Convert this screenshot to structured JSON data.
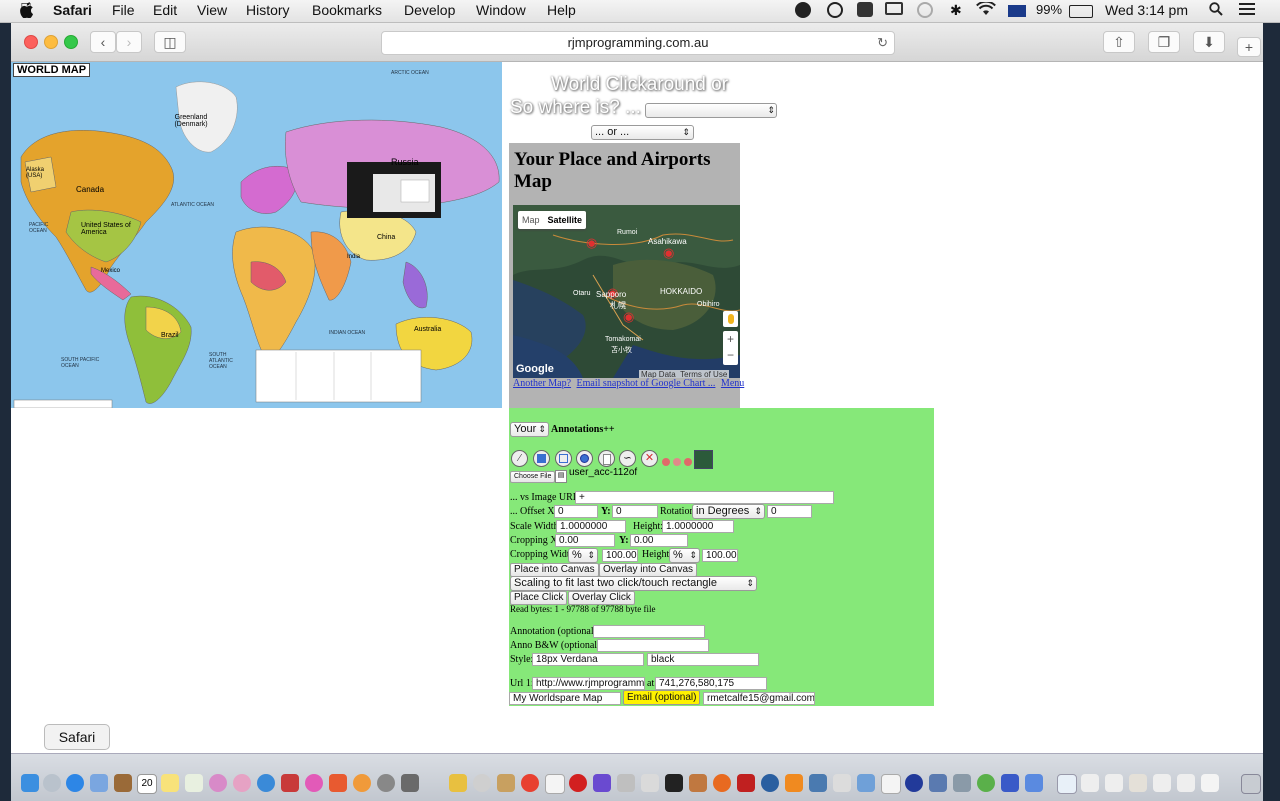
{
  "menubar": {
    "app": "Safari",
    "items": [
      "File",
      "Edit",
      "View",
      "History",
      "Bookmarks",
      "Develop",
      "Window",
      "Help"
    ],
    "battery": "99%",
    "clock": "Wed 3:14 pm"
  },
  "browser": {
    "url": "rjmprogramming.com.au"
  },
  "worldmap": {
    "title": "WORLD MAP",
    "labels": [
      "Greenland (Denmark)",
      "Canada",
      "Alaska (USA)",
      "United States of America",
      "Mexico",
      "Brazil",
      "Russia",
      "China",
      "India",
      "Australia",
      "ATLANTIC OCEAN",
      "PACIFIC OCEAN",
      "INDIAN OCEAN",
      "SOUTH ATLANTIC OCEAN",
      "SOUTH PACIFIC OCEAN",
      "ARCTIC OCEAN"
    ]
  },
  "heading": {
    "line1": "World Clickaround or",
    "line2": "So where is? ...",
    "or_select": "... or ..."
  },
  "place_panel": {
    "title": "Your Place and Airports Map",
    "map_tab": "Map",
    "satellite_tab": "Satellite",
    "map_labels": [
      "Rumoi",
      "Asahikawa",
      "HOKKAIDO",
      "Otaru",
      "Sapporo",
      "札幌",
      "Obihiro",
      "Tomakomai",
      "苫小牧"
    ],
    "google": "Google",
    "map_data": "Map Data",
    "terms": "Terms of Use",
    "zoom_in": "+",
    "zoom_out": "−",
    "links": [
      "Another Map?",
      "Email snapshot of Google Chart ...",
      "Menu"
    ]
  },
  "annotations": {
    "whose_select": "Your",
    "title": "Annotations++",
    "choose_file": "Choose File",
    "file_name": "user_acc-112of",
    "vs_image_url_label": "... vs Image URL:",
    "vs_image_url_value": "+",
    "offset_x_label": "... Offset X:",
    "offset_x_value": "0",
    "y_label": "Y:",
    "offset_y_value": "0",
    "rotation_label": "Rotation",
    "rotation_unit": "in Degrees",
    "rotation_value": "0",
    "scale_width_label": "Scale Width:",
    "scale_width_value": "1.0000000",
    "height_label": "Height:",
    "scale_height_value": "1.0000000",
    "cropping_x_label": "Cropping X:",
    "cropping_x_value": "0.00",
    "cropping_y_value": "0.00",
    "cropping_width_label": "Cropping Width:",
    "crop_width_unit": "%",
    "crop_width_value": "100.00",
    "crop_height_unit": "%",
    "crop_height_value": "100.00",
    "place_into_canvas": "Place into Canvas",
    "overlay_into_canvas": "Overlay into Canvas",
    "scaling_select": "Scaling to fit last two click/touch rectangle",
    "place_click": "Place Click",
    "overlay_click": "Overlay Click",
    "read_bytes": "Read bytes: 1 - 97788 of 97788 byte file",
    "annotation_label": "Annotation (optional):",
    "anno_bw_label": "Anno B&W (optional):",
    "style_label": "Style:",
    "style_font": "18px Verdana",
    "style_color": "black",
    "url1_label": "Url 1:",
    "url1_value": "http://www.rjmprogramming.com.au",
    "at_label": "at",
    "at_value": "741,276,580,175",
    "map_name": "My Worldspare Map",
    "email_button": "Email (optional)",
    "email_value": "rmetcalfe15@gmail.com"
  },
  "dock": {
    "tooltip": "Safari",
    "calendar_day": "20"
  }
}
